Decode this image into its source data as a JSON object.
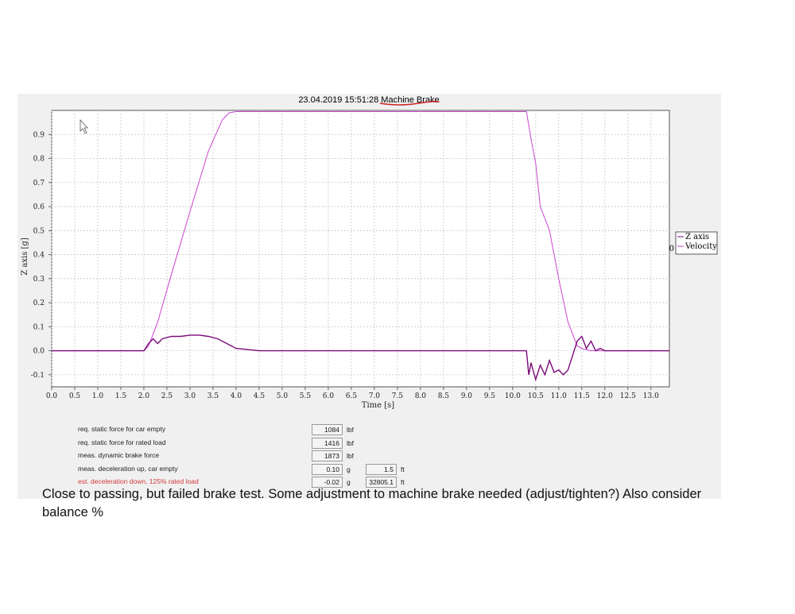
{
  "chart_data": {
    "type": "line",
    "title": "23.04.2019 15:51:28 Machine Brake",
    "xlabel": "Time  [s]",
    "ylabel": "Z axis [g]",
    "xlim": [
      0,
      13.4
    ],
    "ylim": [
      -0.15,
      1.0
    ],
    "x_ticks": [
      "0.0",
      "0.5",
      "1.0",
      "1.5",
      "2.0",
      "2.5",
      "3.0",
      "3.5",
      "4.0",
      "4.5",
      "5.0",
      "5.5",
      "6.0",
      "6.5",
      "7.0",
      "7.5",
      "8.0",
      "8.5",
      "9.0",
      "9.5",
      "10.0",
      "10.5",
      "11.0",
      "11.5",
      "12.0",
      "12.5",
      "13.0"
    ],
    "y_ticks": [
      "0.9",
      "0.8",
      "0.7",
      "0.6",
      "0.5",
      "0.4",
      "0.3",
      "0.2",
      "0.1",
      "0.0",
      "-0.1"
    ],
    "grid": true,
    "legend_position": "right",
    "legend_marker": "0",
    "series": [
      {
        "name": "Velocity",
        "color": "#cc44cc",
        "x": [
          0.0,
          2.0,
          2.1,
          2.3,
          2.6,
          3.0,
          3.4,
          3.7,
          3.85,
          4.0,
          5.0,
          6.0,
          7.0,
          8.0,
          9.0,
          10.0,
          10.3,
          10.4,
          10.5,
          10.6,
          10.8,
          11.0,
          11.2,
          11.4,
          11.5,
          11.7,
          12.0,
          13.4
        ],
        "values": [
          0.0,
          0.0,
          0.02,
          0.12,
          0.32,
          0.58,
          0.83,
          0.96,
          0.99,
          0.995,
          0.995,
          0.995,
          0.995,
          0.995,
          0.995,
          0.995,
          0.995,
          0.88,
          0.78,
          0.6,
          0.5,
          0.3,
          0.12,
          0.02,
          0.01,
          0.0,
          0.0,
          0.0
        ]
      },
      {
        "name": "Z axis",
        "color": "#7a0a7a",
        "x": [
          0.0,
          2.0,
          2.1,
          2.2,
          2.3,
          2.4,
          2.6,
          2.8,
          3.0,
          3.2,
          3.4,
          3.6,
          3.8,
          4.0,
          4.5,
          5.0,
          6.0,
          7.0,
          8.0,
          9.0,
          10.0,
          10.3,
          10.35,
          10.4,
          10.5,
          10.6,
          10.7,
          10.8,
          10.9,
          11.0,
          11.1,
          11.2,
          11.3,
          11.4,
          11.5,
          11.6,
          11.7,
          11.8,
          11.9,
          12.0,
          13.4
        ],
        "values": [
          0.0,
          0.0,
          0.03,
          0.05,
          0.03,
          0.05,
          0.06,
          0.06,
          0.065,
          0.065,
          0.06,
          0.05,
          0.03,
          0.01,
          0.0,
          0.0,
          0.0,
          0.0,
          0.0,
          0.0,
          0.0,
          0.0,
          -0.1,
          -0.05,
          -0.12,
          -0.06,
          -0.1,
          -0.04,
          -0.09,
          -0.08,
          -0.1,
          -0.08,
          -0.02,
          0.04,
          0.06,
          0.01,
          0.04,
          0.0,
          0.01,
          0.0,
          0.0
        ]
      }
    ]
  },
  "measurements": [
    {
      "label": "req. static force for car empty",
      "value": "1084",
      "unit": "lbf"
    },
    {
      "label": "req. static force for rated load",
      "value": "1416",
      "unit": "lbf"
    },
    {
      "label": "meas. dynamic brake force",
      "value": "1873",
      "unit": "lbf"
    },
    {
      "label": "meas. deceleration up, car empty",
      "value": "0.10",
      "unit": "g",
      "value2": "1.5",
      "unit2": "ft"
    },
    {
      "label": "est. deceleration down, 125% rated load",
      "value": "-0.02",
      "unit": "g",
      "value2": "32805.1",
      "unit2": "ft",
      "highlight": true
    }
  ],
  "note": "Close to passing, but failed brake test.  Some adjustment to machine brake needed (adjust/tighten?) Also consider balance %",
  "colors": {
    "panel_bg": "#f0f0f0",
    "underline": "#cc2222",
    "highlight_text": "#d33a3a"
  },
  "icons": {
    "cursor": "mouse-pointer-icon"
  }
}
